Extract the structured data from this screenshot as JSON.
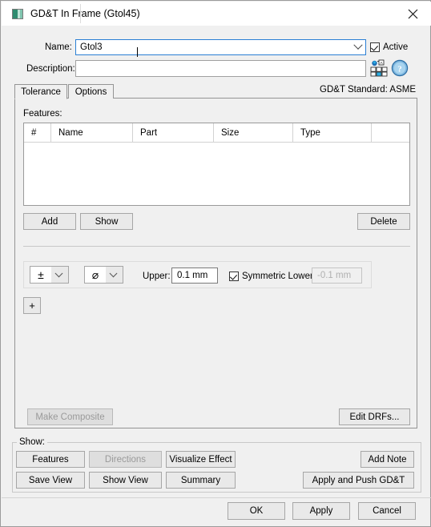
{
  "window": {
    "title": "GD&T In Frame (Gtol45)",
    "icon": "application-icon",
    "close_label": "×"
  },
  "form": {
    "name_label": "Name:",
    "name_value": "Gtol3",
    "name_placeholder": "",
    "active_label": "Active",
    "active_checked": true,
    "description_label": "Description:",
    "description_value": "",
    "description_placeholder": "",
    "gdt_symbol_icon": "gdt-symbol-palette-icon",
    "help_icon": "help-icon"
  },
  "tabs": {
    "items": [
      {
        "label": "Tolerance",
        "active": true
      },
      {
        "label": "Options",
        "active": false
      }
    ],
    "standard_label": "GD&T Standard: ASME"
  },
  "features": {
    "label": "Features:",
    "columns": [
      "#",
      "Name",
      "Part",
      "Size",
      "Type",
      ""
    ],
    "rows": [],
    "add_label": "Add",
    "show_label": "Show",
    "delete_label": "Delete"
  },
  "tolerance": {
    "modifier_symbol": "±",
    "shape_symbol": "⌀",
    "upper_label": "Upper:",
    "upper_value": "0.1 mm",
    "symmetric_lower_label": "Symmetric Lower:",
    "symmetric_lower_checked": true,
    "lower_value": "-0.1 mm",
    "lower_disabled": true,
    "add_row_label": "+"
  },
  "composite": {
    "make_composite_label": "Make Composite",
    "make_composite_disabled": true,
    "edit_drfs_label": "Edit DRFs..."
  },
  "show_group": {
    "label": "Show:",
    "buttons": [
      {
        "label": "Features",
        "disabled": false
      },
      {
        "label": "Directions",
        "disabled": true
      },
      {
        "label": "Visualize Effect",
        "disabled": false
      },
      {
        "label": "Add Note",
        "disabled": false
      },
      {
        "label": "Save View",
        "disabled": false
      },
      {
        "label": "Show View",
        "disabled": false
      },
      {
        "label": "Summary",
        "disabled": false
      },
      {
        "label": "Apply and Push GD&T",
        "disabled": false
      }
    ]
  },
  "footer": {
    "ok_label": "OK",
    "apply_label": "Apply",
    "cancel_label": "Cancel"
  },
  "colors": {
    "dialog_bg": "#f0f0f0",
    "focus_border": "#2a7fd4",
    "button_bg": "#e9e9e9",
    "disabled_text": "#9a9a9a"
  }
}
